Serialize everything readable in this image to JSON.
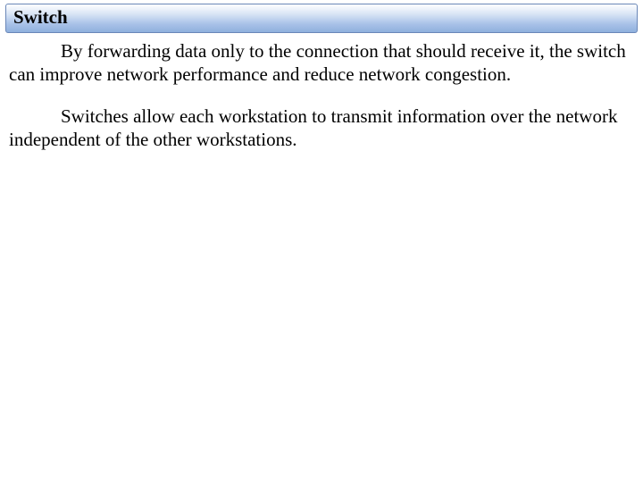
{
  "header": {
    "title": "Switch"
  },
  "content": {
    "paragraphs": [
      "By forwarding data only to the connection that should receive it, the switch can improve network performance and reduce network congestion.",
      "Switches allow each workstation to transmit information over the network independent of the other workstations."
    ]
  }
}
